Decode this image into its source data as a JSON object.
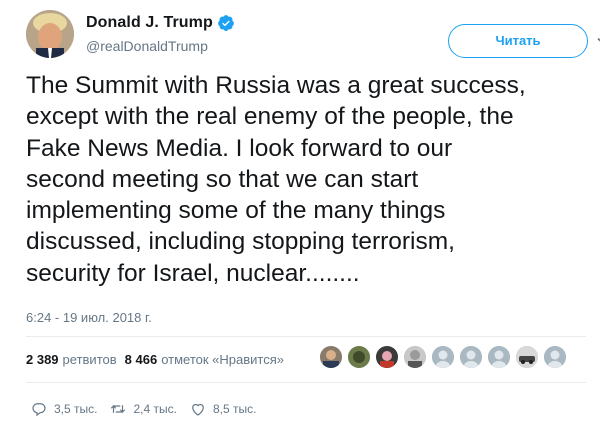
{
  "header": {
    "display_name": "Donald J. Trump",
    "handle": "@realDonaldTrump",
    "follow_label": "Читать"
  },
  "tweet": {
    "text": "The Summit with Russia was a great success,\nexcept with the real enemy of the people, the\nFake News Media. I look forward to our\nsecond meeting so that we can start\nimplementing some of the many things\ndiscussed, including stopping terrorism,\nsecurity for Israel, nuclear........",
    "timestamp": "6:24 - 19 июл. 2018 г."
  },
  "stats": {
    "retweets_count": "2 389",
    "retweets_label": "ретвитов",
    "likes_count": "8 466",
    "likes_label": "отметок «Нравится»"
  },
  "likers": [
    "liker-1",
    "liker-2",
    "liker-3",
    "liker-4",
    "liker-5",
    "liker-6",
    "liker-7",
    "liker-8",
    "liker-9"
  ],
  "actions": {
    "replies": "3,5 тыс.",
    "retweets": "2,4 тыс.",
    "likes": "8,5 тыс."
  },
  "colors": {
    "accent": "#1da1f2",
    "muted": "#657786",
    "text": "#14171a",
    "divider": "#e6ecf0"
  }
}
